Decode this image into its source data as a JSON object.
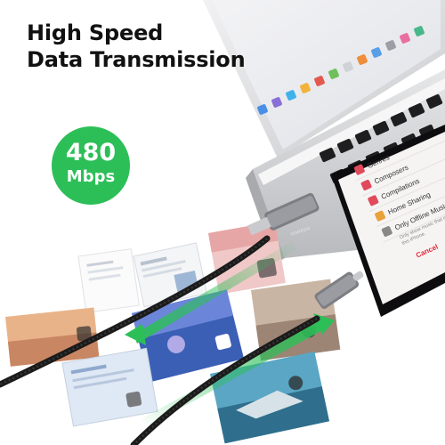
{
  "headline": {
    "line1": "High Speed",
    "line2": "Data Transmission"
  },
  "badge": {
    "value": "480",
    "unit": "Mbps",
    "color": "#2cbf57"
  },
  "phone_menu": {
    "items": [
      {
        "label": "Genres"
      },
      {
        "label": "Composers"
      },
      {
        "label": "Compilations"
      },
      {
        "label": "Home Sharing"
      },
      {
        "label": "Only Offline Music"
      }
    ],
    "note": "Only show music that is stored on this iPhone.",
    "cancel_label": "Cancel"
  },
  "cable_brand": "UGREEN",
  "colors": {
    "accent_green": "#2cbf57",
    "laptop_silver": "#d9dadc",
    "keyboard": "#1e1e20",
    "cable": "#1b1b1b"
  }
}
